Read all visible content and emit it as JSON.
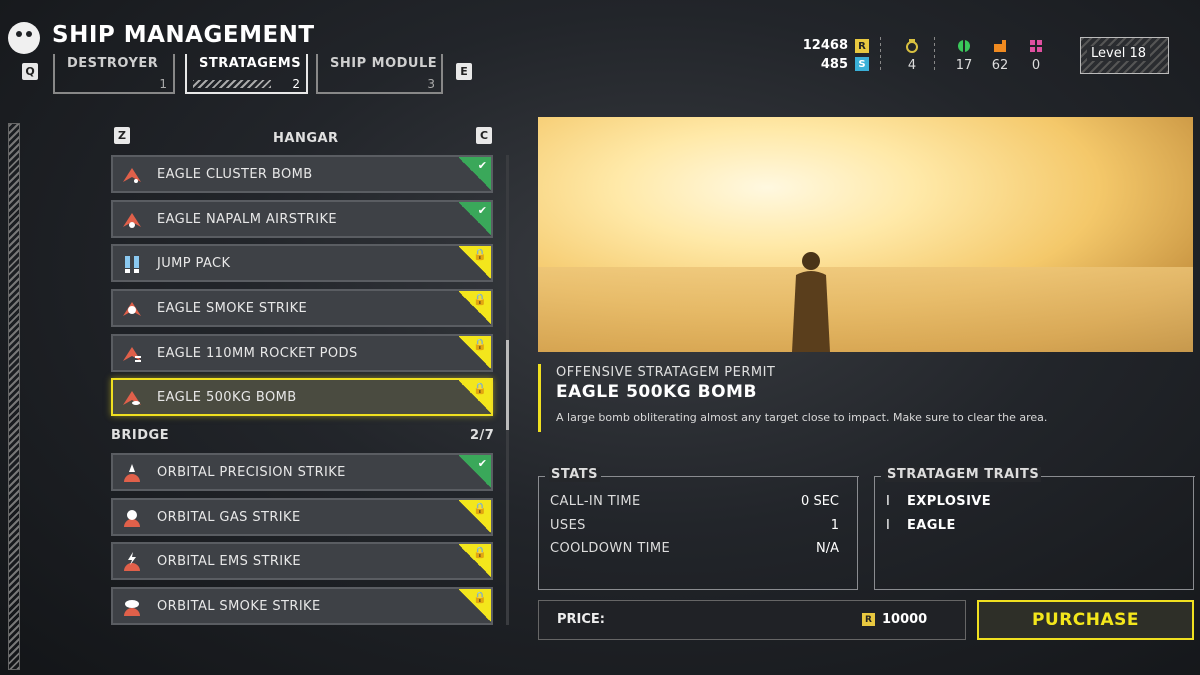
{
  "header": {
    "title": "SHIP MANAGEMENT",
    "tab_prev_key": "Q",
    "tab_next_key": "E",
    "tabs": [
      {
        "label": "DESTROYER",
        "number": "1"
      },
      {
        "label": "STRATAGEMS",
        "number": "2"
      },
      {
        "label": "SHIP MODULE",
        "number": "3"
      }
    ]
  },
  "currencies": {
    "requisition": {
      "value": "12468",
      "icon": "R"
    },
    "credits": {
      "value": "485",
      "icon": "S"
    },
    "medals": {
      "value": "4"
    },
    "samples_common": {
      "value": "17"
    },
    "samples_rare": {
      "value": "62"
    },
    "samples_super": {
      "value": "0"
    },
    "level": "Level 18"
  },
  "list": {
    "prev_key": "Z",
    "next_key": "C",
    "hangar_label": "HANGAR",
    "hangar_items": [
      {
        "label": "EAGLE CLUSTER BOMB",
        "status": "owned"
      },
      {
        "label": "EAGLE NAPALM AIRSTRIKE",
        "status": "owned"
      },
      {
        "label": "JUMP PACK",
        "status": "locked"
      },
      {
        "label": "EAGLE SMOKE STRIKE",
        "status": "locked"
      },
      {
        "label": "EAGLE 110MM ROCKET PODS",
        "status": "locked"
      },
      {
        "label": "EAGLE 500KG BOMB",
        "status": "locked"
      }
    ],
    "bridge_label": "BRIDGE",
    "bridge_count": "2/7",
    "bridge_items": [
      {
        "label": "ORBITAL PRECISION STRIKE",
        "status": "owned"
      },
      {
        "label": "ORBITAL GAS STRIKE",
        "status": "locked"
      },
      {
        "label": "ORBITAL EMS STRIKE",
        "status": "locked"
      },
      {
        "label": "ORBITAL SMOKE STRIKE",
        "status": "locked"
      }
    ]
  },
  "detail": {
    "permit": "OFFENSIVE STRATAGEM PERMIT",
    "name": "EAGLE 500KG BOMB",
    "description": "A large bomb obliterating almost any target close to impact. Make sure to clear the area.",
    "stats_title": "STATS",
    "stats": [
      {
        "name": "CALL-IN TIME",
        "value": "0 SEC"
      },
      {
        "name": "USES",
        "value": "1"
      },
      {
        "name": "COOLDOWN TIME",
        "value": "N/A"
      }
    ],
    "traits_title": "STRATAGEM TRAITS",
    "traits": [
      "EXPLOSIVE",
      "EAGLE"
    ],
    "price_label": "PRICE:",
    "price_icon": "R",
    "price_value": "10000",
    "purchase_label": "PURCHASE"
  },
  "colors": {
    "accent_yellow": "#f3e61c",
    "owned_green": "#3aa85a",
    "icon_red": "#e0604a"
  }
}
